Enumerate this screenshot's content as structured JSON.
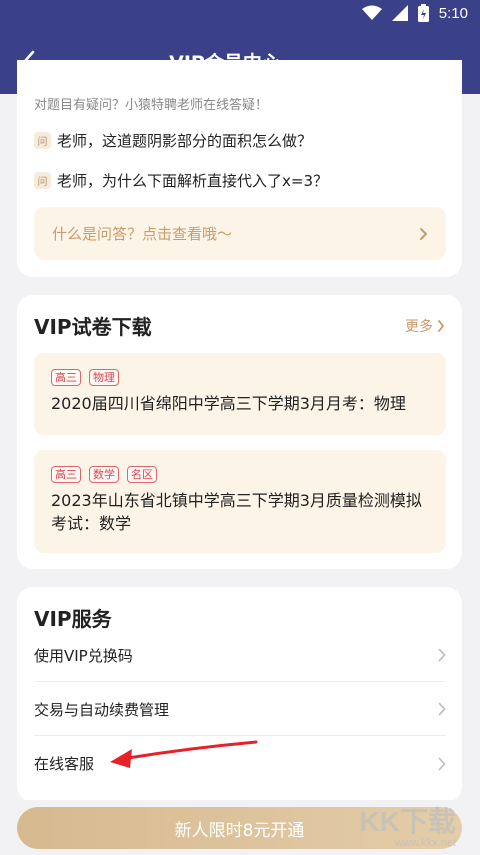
{
  "status_bar": {
    "time": "5:10",
    "icons": [
      "wifi-icon",
      "signal-icon",
      "battery-icon"
    ]
  },
  "header": {
    "title": "VIP会员中心",
    "back_icon": "chevron-left-icon"
  },
  "qa_section": {
    "hint": "对题目有疑问？小猿特聘老师在线答疑！",
    "badge": "问",
    "questions": [
      "老师，这道题阴影部分的面积怎么做？",
      "老师，为什么下面解析直接代入了x=3？"
    ],
    "link_label": "什么是问答？点击查看哦～"
  },
  "papers_section": {
    "title": "VIP试卷下载",
    "more_label": "更多",
    "papers": [
      {
        "tags": [
          "高三",
          "物理"
        ],
        "title": "2020届四川省绵阳中学高三下学期3月月考：物理"
      },
      {
        "tags": [
          "高三",
          "数学",
          "名区"
        ],
        "title": "2023年山东省北镇中学高三下学期3月质量检测模拟考试：数学"
      }
    ]
  },
  "vip_services": {
    "title": "VIP服务",
    "items": [
      "使用VIP兑换码",
      "交易与自动续费管理",
      "在线客服"
    ]
  },
  "bottom_bar": {
    "open_label": "新人限时8元开通"
  },
  "watermark": {
    "main": "KK下载",
    "sub": "www.kkx.net"
  },
  "colors": {
    "header_bg": "#3a4189",
    "accent": "#c99b6a",
    "tag_red": "#d9474f",
    "button_gold": "#d6b98f",
    "annotation_arrow": "#e8202a"
  }
}
